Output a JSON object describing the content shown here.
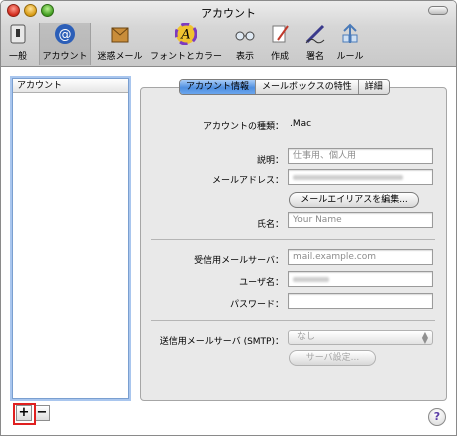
{
  "window": {
    "title": "アカウント"
  },
  "toolbar": {
    "items": [
      {
        "label": "一般",
        "icon": "switch-icon"
      },
      {
        "label": "アカウント",
        "icon": "at-sign-icon",
        "selected": true
      },
      {
        "label": "迷惑メール",
        "icon": "junk-mail-icon"
      },
      {
        "label": "フォントとカラー",
        "icon": "font-color-icon"
      },
      {
        "label": "表示",
        "icon": "glasses-icon"
      },
      {
        "label": "作成",
        "icon": "compose-pen-icon"
      },
      {
        "label": "署名",
        "icon": "signature-pen-icon"
      },
      {
        "label": "ルール",
        "icon": "rules-icon"
      }
    ]
  },
  "sidebar": {
    "header": "アカウント",
    "add_label": "+",
    "remove_label": "−"
  },
  "tabs": [
    {
      "label": "アカウント情報",
      "active": true
    },
    {
      "label": "メールボックスの特性",
      "active": false
    },
    {
      "label": "詳細",
      "active": false
    }
  ],
  "account_info": {
    "type_label": "アカウントの種類：",
    "type_value": ".Mac",
    "description_label": "説明：",
    "description_placeholder": "仕事用、個人用",
    "email_label": "メールアドレス：",
    "edit_alias_button": "メールエイリアスを編集...",
    "name_label": "氏名：",
    "name_placeholder": "Your Name",
    "incoming_label": "受信用メールサーバ：",
    "incoming_placeholder": "mail.example.com",
    "username_label": "ユーザ名：",
    "password_label": "パスワード：",
    "smtp_label": "送信用メールサーバ (SMTP)：",
    "smtp_value": "なし",
    "server_settings_button": "サーバ設定..."
  },
  "help": {
    "label": "?"
  },
  "colors": {
    "accent": "#4f8fe0",
    "highlight": "#e02020"
  }
}
